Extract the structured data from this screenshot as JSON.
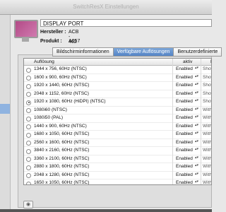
{
  "window": {
    "title": "SwitchResX Einstellungen"
  },
  "display": {
    "name": "DISPLAY PORT",
    "manufacturer_label": "Hersteller :",
    "manufacturer_value": "ACB - 462",
    "product_label": "Produkt :",
    "product_value": "A057"
  },
  "tabs": [
    {
      "label": "Bildschirminformationen",
      "active": false
    },
    {
      "label": "Verfügbare Auflösungen",
      "active": true
    },
    {
      "label": "Benutzerdefinierte",
      "active": false
    }
  ],
  "table": {
    "columns": {
      "resolution": "Auflösung",
      "active": "aktiv",
      "visible": "M"
    },
    "rows": [
      {
        "selected": false,
        "resolution": "1344 x 756, 60Hz (NTSC)",
        "status": "Enabled",
        "visible": "Show"
      },
      {
        "selected": false,
        "resolution": "1600 x 900, 60Hz (NTSC)",
        "status": "Enabled",
        "visible": "Show"
      },
      {
        "selected": false,
        "resolution": "1920 x 1440, 60Hz (NTSC)",
        "status": "Enabled",
        "visible": "Show"
      },
      {
        "selected": false,
        "resolution": "2048 x 1152, 60Hz (NTSC)",
        "status": "Enabled",
        "visible": "Show"
      },
      {
        "selected": true,
        "resolution": "1920 x 1080, 60Hz (HiDPI) (NTSC)",
        "status": "Enabled",
        "visible": "Show"
      },
      {
        "selected": false,
        "resolution": "1080i60 (NTSC)",
        "status": "Enabled",
        "visible": "With"
      },
      {
        "selected": false,
        "resolution": "1080i50 (PAL)",
        "status": "Enabled",
        "visible": "With"
      },
      {
        "selected": false,
        "resolution": "1440 x 900, 60Hz (NTSC)",
        "status": "Enabled",
        "visible": "With"
      },
      {
        "selected": false,
        "resolution": "1680 x 1050, 60Hz (NTSC)",
        "status": "Enabled",
        "visible": "With"
      },
      {
        "selected": false,
        "resolution": "2560 x 1600, 60Hz (NTSC)",
        "status": "Enabled",
        "visible": "With"
      },
      {
        "selected": false,
        "resolution": "3840 x 2160, 60Hz (NTSC)",
        "status": "Enabled",
        "visible": "With"
      },
      {
        "selected": false,
        "resolution": "3360 x 2100, 60Hz (NTSC)",
        "status": "Enabled",
        "visible": "With"
      },
      {
        "selected": false,
        "resolution": "2880 x 1800, 60Hz (NTSC)",
        "status": "Enabled",
        "visible": "With"
      },
      {
        "selected": false,
        "resolution": "2048 x 1280, 60Hz (NTSC)",
        "status": "Enabled",
        "visible": "With"
      },
      {
        "selected": false,
        "resolution": "1650 x 1050, 60Hz (NTSC)",
        "status": "Enabled",
        "visible": "With"
      }
    ]
  },
  "icons": {
    "display": "monitor-icon",
    "preview": "eye-icon",
    "dropdown": "updown-arrow-icon"
  }
}
